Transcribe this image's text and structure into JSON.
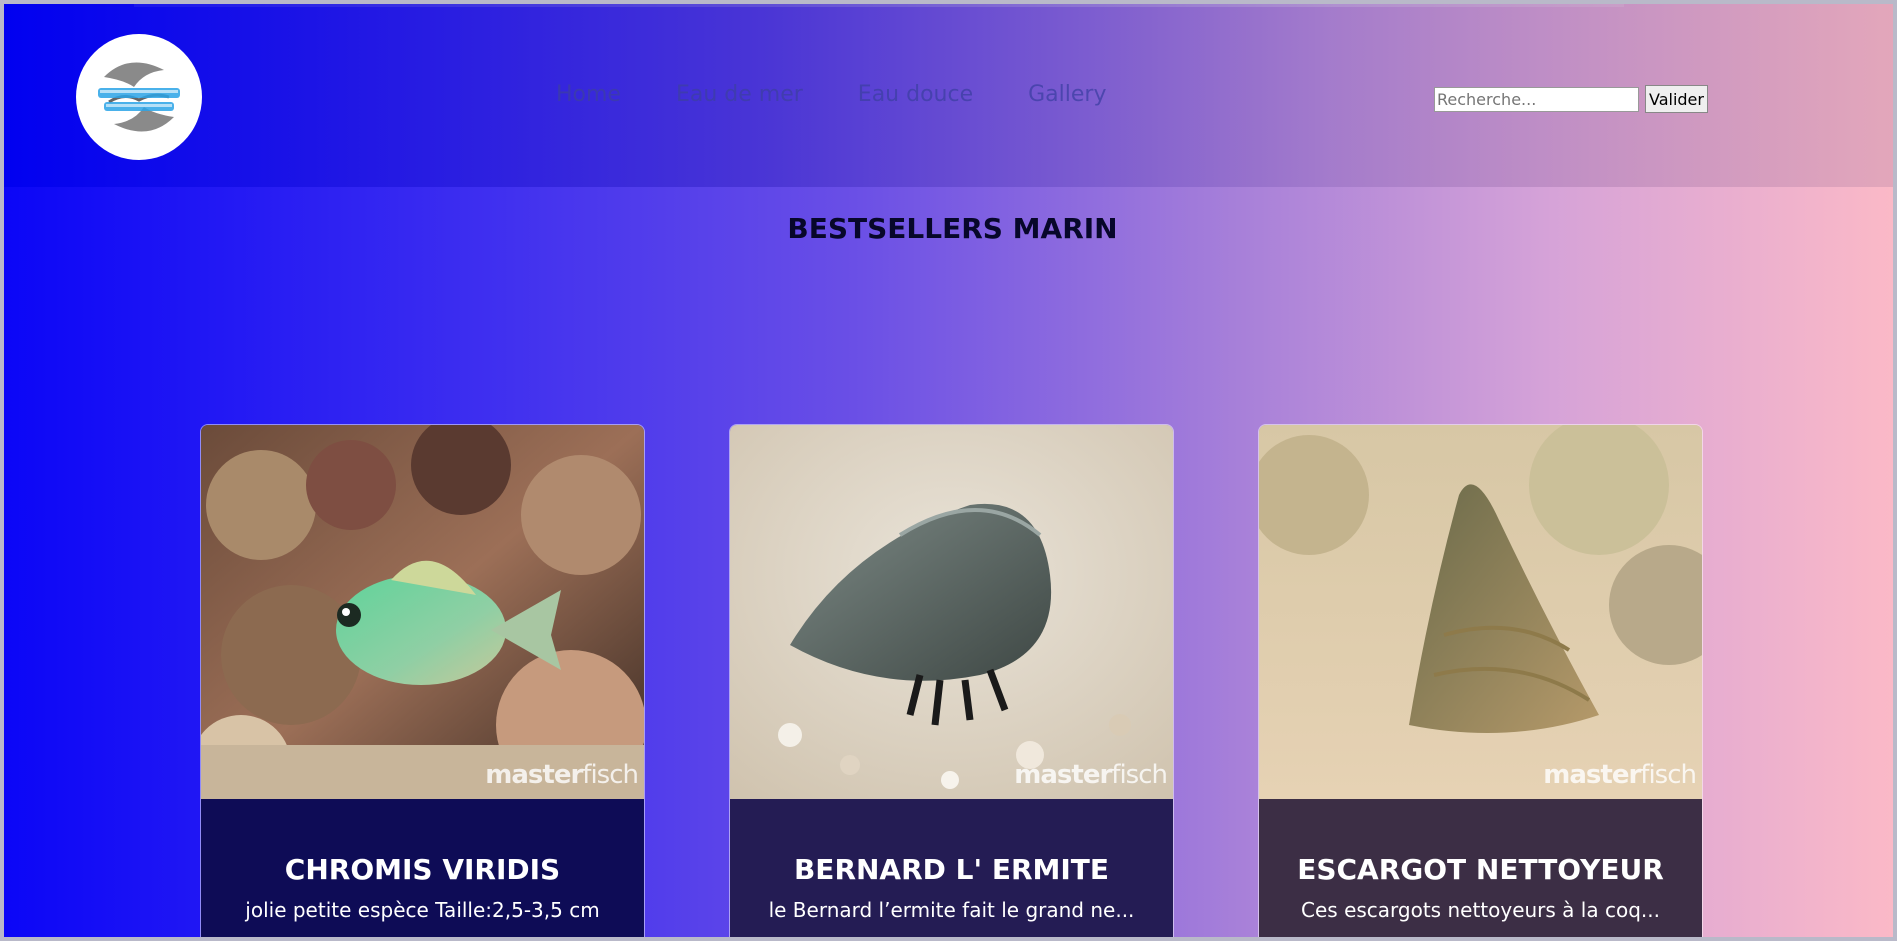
{
  "header": {
    "logo_name": "fish-logo",
    "nav": [
      {
        "label": "Home"
      },
      {
        "label": "Eau de mer"
      },
      {
        "label": "Eau douce"
      },
      {
        "label": "Gallery"
      }
    ],
    "search": {
      "placeholder": "Recherche...",
      "value": "",
      "button_label": "Valider"
    }
  },
  "main": {
    "title": "BESTSELLERS MARIN",
    "cards": [
      {
        "name": "CHROMIS VIRIDIS",
        "description": "jolie petite espèce Taille:2,5-3,5 cm",
        "watermark_bold": "master",
        "watermark_light": "fisch",
        "body_color": "#0e0c56"
      },
      {
        "name": "BERNARD L' ERMITE",
        "description": "le Bernard l’ermite fait le grand ne...",
        "watermark_bold": "master",
        "watermark_light": "fisch",
        "body_color": "#241c54"
      },
      {
        "name": "ESCARGOT NETTOYEUR",
        "description": "Ces escargots nettoyeurs à la coq...",
        "watermark_bold": "master",
        "watermark_light": "fisch",
        "body_color": "#3c2e45"
      }
    ]
  },
  "colors": {
    "accent_price": "#3bb7ff",
    "title": "#07072a",
    "nav_text": "#3d3fa3"
  }
}
